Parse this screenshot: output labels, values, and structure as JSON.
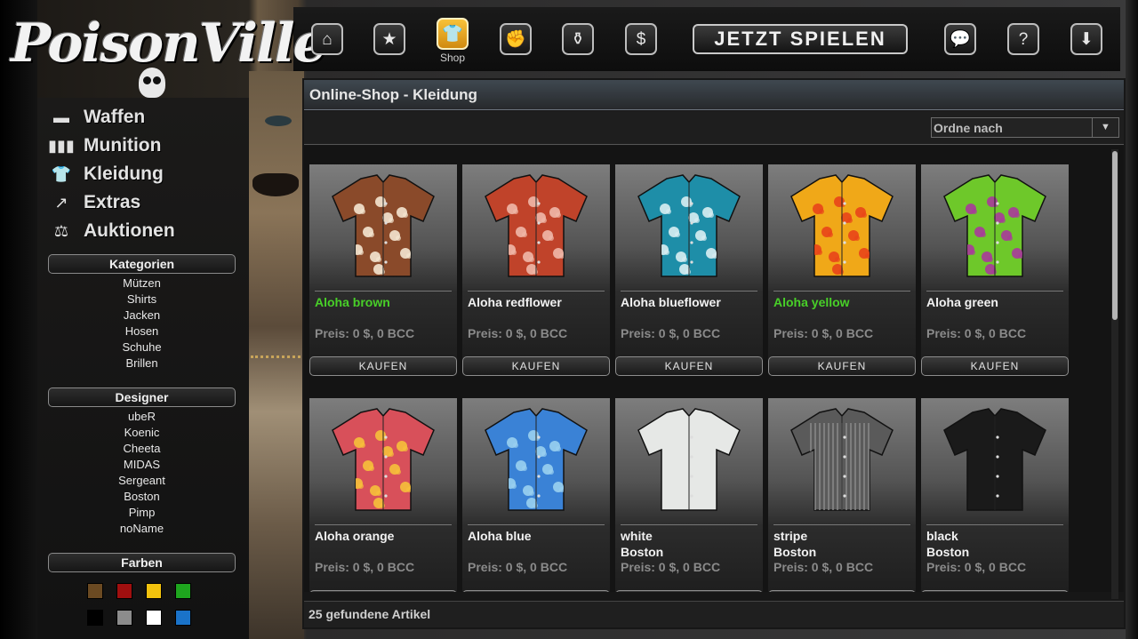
{
  "app": {
    "logo": "PoisonVille"
  },
  "topnav": {
    "buttons": [
      {
        "icon": "home-icon",
        "glyph": "⌂"
      },
      {
        "icon": "star-icon",
        "glyph": "★"
      },
      {
        "icon": "shirt-icon",
        "glyph": "👕",
        "label": "Shop",
        "active": true
      },
      {
        "icon": "fist-icon",
        "glyph": "✊"
      },
      {
        "icon": "bottles-icon",
        "glyph": "⚱"
      },
      {
        "icon": "dollar-icon",
        "glyph": "$"
      },
      {
        "icon": "chat-icon",
        "glyph": "💬"
      },
      {
        "icon": "help-icon",
        "glyph": "?"
      },
      {
        "icon": "download-icon",
        "glyph": "⬇"
      }
    ],
    "shop_label": "Shop",
    "play_label": "JETZT SPIELEN"
  },
  "sidebar": {
    "menu": [
      {
        "label": "Waffen",
        "icon": "pistol-icon",
        "glyph": "▬"
      },
      {
        "label": "Munition",
        "icon": "ammo-icon",
        "glyph": "▮▮▮"
      },
      {
        "label": "Kleidung",
        "icon": "shirt-icon",
        "glyph": "👕"
      },
      {
        "label": "Extras",
        "icon": "arrow-icon",
        "glyph": "↗"
      },
      {
        "label": "Auktionen",
        "icon": "gavel-icon",
        "glyph": "⚖"
      }
    ],
    "categories_title": "Kategorien",
    "categories": [
      "Mützen",
      "Shirts",
      "Jacken",
      "Hosen",
      "Schuhe",
      "Brillen"
    ],
    "designer_title": "Designer",
    "designers": [
      "ubeR",
      "Koenic",
      "Cheeta",
      "MIDAS",
      "Sergeant",
      "Boston",
      "Pimp",
      "noName"
    ],
    "colors_title": "Farben",
    "colors": [
      "#6b4a22",
      "#a00f0f",
      "#f2c20d",
      "#1ea51e",
      "#000000",
      "#8c8c8c",
      "#ffffff",
      "#1a73c9"
    ]
  },
  "main": {
    "title": "Online-Shop - Kleidung",
    "sort_placeholder": "Ordne nach",
    "buy_label": "KAUFEN",
    "items": [
      {
        "name": "Aloha brown",
        "price": "Preis: 0 $, 0 BCC",
        "highlight": true,
        "base": "#8a4a2a",
        "accent": "#f4e6d0"
      },
      {
        "name": "Aloha redflower",
        "price": "Preis: 0 $, 0 BCC",
        "highlight": false,
        "base": "#c0432a",
        "accent": "#f0b8a8"
      },
      {
        "name": "Aloha blueflower",
        "price": "Preis: 0 $, 0 BCC",
        "highlight": false,
        "base": "#1e8ea8",
        "accent": "#d8eef2"
      },
      {
        "name": "Aloha yellow",
        "price": "Preis: 0 $, 0 BCC",
        "highlight": true,
        "base": "#f0a818",
        "accent": "#e8441a"
      },
      {
        "name": "Aloha green",
        "price": "Preis: 0 $, 0 BCC",
        "highlight": false,
        "base": "#6ec82a",
        "accent": "#a83a9a"
      },
      {
        "name": "Aloha orange",
        "price": "Preis: 0 $, 0 BCC",
        "highlight": false,
        "base": "#d8505a",
        "accent": "#f6c03a"
      },
      {
        "name": "Aloha blue",
        "price": "Preis: 0 $, 0 BCC",
        "highlight": false,
        "base": "#3a82d6",
        "accent": "#9ad0f0"
      },
      {
        "name": "white",
        "brand": "Boston",
        "price": "Preis: 0 $, 0 BCC",
        "highlight": false,
        "base": "#e6e8e6",
        "accent": "#ffffff"
      },
      {
        "name": "stripe",
        "brand": "Boston",
        "price": "Preis: 0 $, 0 BCC",
        "highlight": false,
        "base": "#5a5a5a",
        "accent": "#8a8a8a"
      },
      {
        "name": "black",
        "brand": "Boston",
        "price": "Preis: 0 $, 0 BCC",
        "highlight": false,
        "base": "#1a1a1a",
        "accent": "#2c2c2c"
      }
    ],
    "footer": "25 gefundene Artikel"
  }
}
